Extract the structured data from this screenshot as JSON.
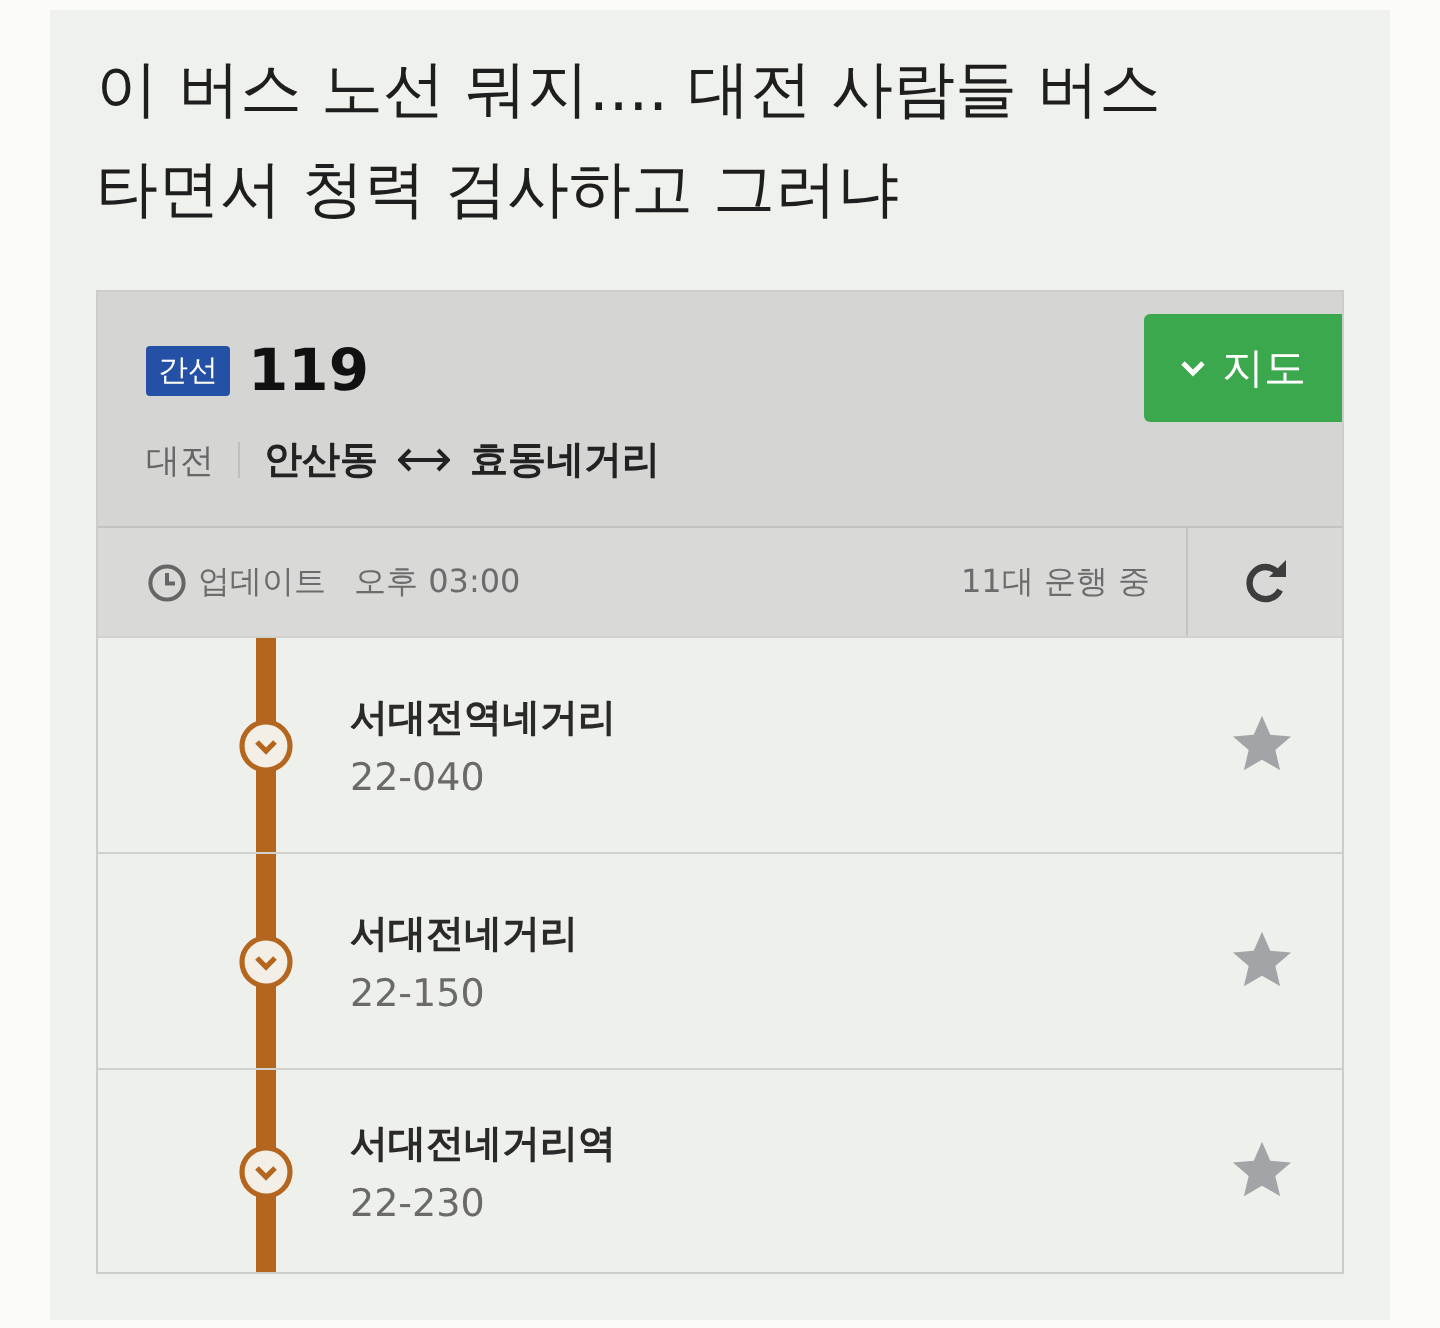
{
  "post": {
    "title": "이 버스 노선 뭐지.... 대전 사람들 버스 타면서 청력 검사하고 그러냐"
  },
  "route": {
    "badge": "간선",
    "number": "119",
    "region": "대전",
    "origin": "안산동",
    "destination": "효동네거리",
    "map_button": "지도"
  },
  "status_bar": {
    "updated_label": "업데이트",
    "time": "오후 03:00",
    "vehicles": "11대 운행 중"
  },
  "stops": [
    {
      "name": "서대전역네거리",
      "code": "22-040",
      "favorite": false
    },
    {
      "name": "서대전네거리",
      "code": "22-150",
      "favorite": false
    },
    {
      "name": "서대전네거리역",
      "code": "22-230",
      "favorite": false
    }
  ]
}
